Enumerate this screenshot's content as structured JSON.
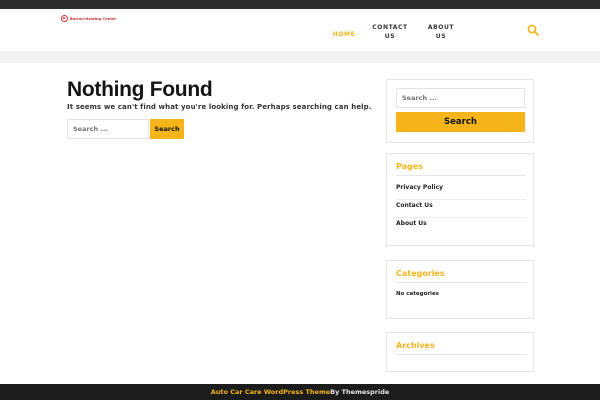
{
  "header": {
    "logo_text": "Barron Holding Center",
    "nav": {
      "home": "HOME",
      "contact": "CONTACT US",
      "about": "ABOUT US"
    }
  },
  "main": {
    "title": "Nothing Found",
    "message": "It seems we can't find what you're looking for. Perhaps searching can help.",
    "search": {
      "placeholder": "Search ...",
      "button": "Search"
    }
  },
  "sidebar": {
    "search": {
      "placeholder": "Search ...",
      "button": "Search"
    },
    "pages": {
      "title": "Pages",
      "items": [
        {
          "label": "Privacy Policy"
        },
        {
          "label": "Contact Us"
        },
        {
          "label": "About Us"
        }
      ]
    },
    "categories": {
      "title": "Categories",
      "empty_text": "No categories"
    },
    "archives": {
      "title": "Archives"
    }
  },
  "footer": {
    "theme_link": "Auto Car Care WordPress Theme",
    "by_text": "By Themespride"
  },
  "colors": {
    "accent": "#f4b41a",
    "topbar": "#2c2c2c",
    "footer_bg": "#1c1c1c"
  },
  "icons": {
    "search": "search-icon",
    "logo": "logo-mark-icon"
  }
}
